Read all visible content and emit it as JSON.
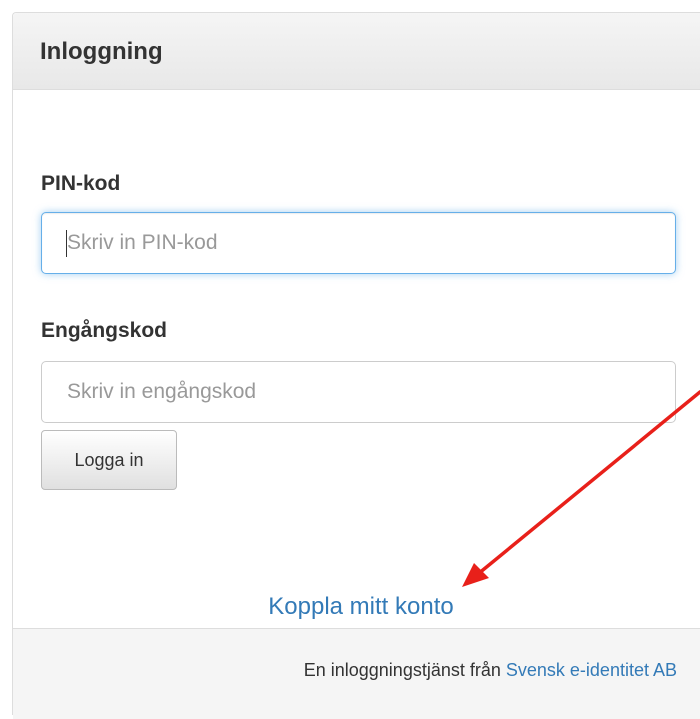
{
  "panel": {
    "title": "Inloggning"
  },
  "form": {
    "pin": {
      "label": "PIN-kod",
      "placeholder": "Skriv in PIN-kod",
      "value": ""
    },
    "otp": {
      "label": "Engångskod",
      "placeholder": "Skriv in engångskod",
      "value": ""
    },
    "submit_label": "Logga in"
  },
  "connect_link": "Koppla mitt konto",
  "footer": {
    "prefix": "En inloggningstjänst från",
    "link": "Svensk e-identitet AB"
  },
  "annotation": {
    "arrow_color": "#e8201a"
  },
  "colors": {
    "link": "#337ab7",
    "focus_border": "#66afe9",
    "footer_bg": "#f5f5f5"
  }
}
